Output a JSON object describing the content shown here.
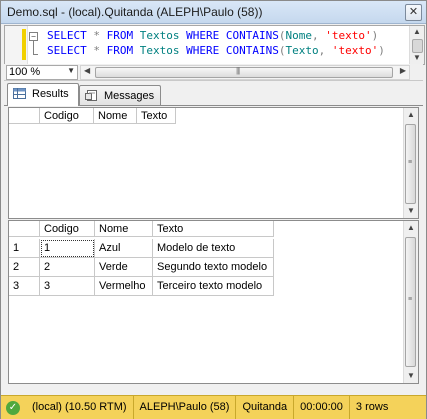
{
  "window": {
    "title": "Demo.sql - (local).Quitanda (ALEPH\\Paulo (58))",
    "close_glyph": "✕"
  },
  "editor": {
    "lines": [
      {
        "kw1": "SELECT",
        "star": "*",
        "kw2": "FROM",
        "table": "Textos",
        "kw3": "WHERE",
        "fn": "CONTAINS",
        "col": "Nome",
        "str": "'texto'"
      },
      {
        "kw1": "SELECT",
        "star": "*",
        "kw2": "FROM",
        "table": "Textos",
        "kw3": "WHERE",
        "fn": "CONTAINS",
        "col": "Texto",
        "str": "'texto'"
      }
    ]
  },
  "zoom": {
    "value": "100 %"
  },
  "tabs": [
    {
      "label": "Results",
      "icon": "grid-results-icon",
      "active": true
    },
    {
      "label": "Messages",
      "icon": "messages-icon",
      "active": false
    }
  ],
  "results": [
    {
      "columns": [
        "Codigo",
        "Nome",
        "Texto"
      ],
      "rows": []
    },
    {
      "columns": [
        "Codigo",
        "Nome",
        "Texto"
      ],
      "rows": [
        {
          "n": "1",
          "codigo": "1",
          "nome": "Azul",
          "texto": "Modelo de texto"
        },
        {
          "n": "2",
          "codigo": "2",
          "nome": "Verde",
          "texto": "Segundo texto modelo"
        },
        {
          "n": "3",
          "codigo": "3",
          "nome": "Vermelho",
          "texto": "Terceiro texto modelo"
        }
      ]
    }
  ],
  "statusbar": {
    "server": "(local) (10.50 RTM)",
    "user": "ALEPH\\Paulo (58)",
    "database": "Quitanda",
    "elapsed": "00:00:00",
    "rows": "3 rows",
    "status_icon": "success-check-icon",
    "accent": "#f4d25a"
  }
}
